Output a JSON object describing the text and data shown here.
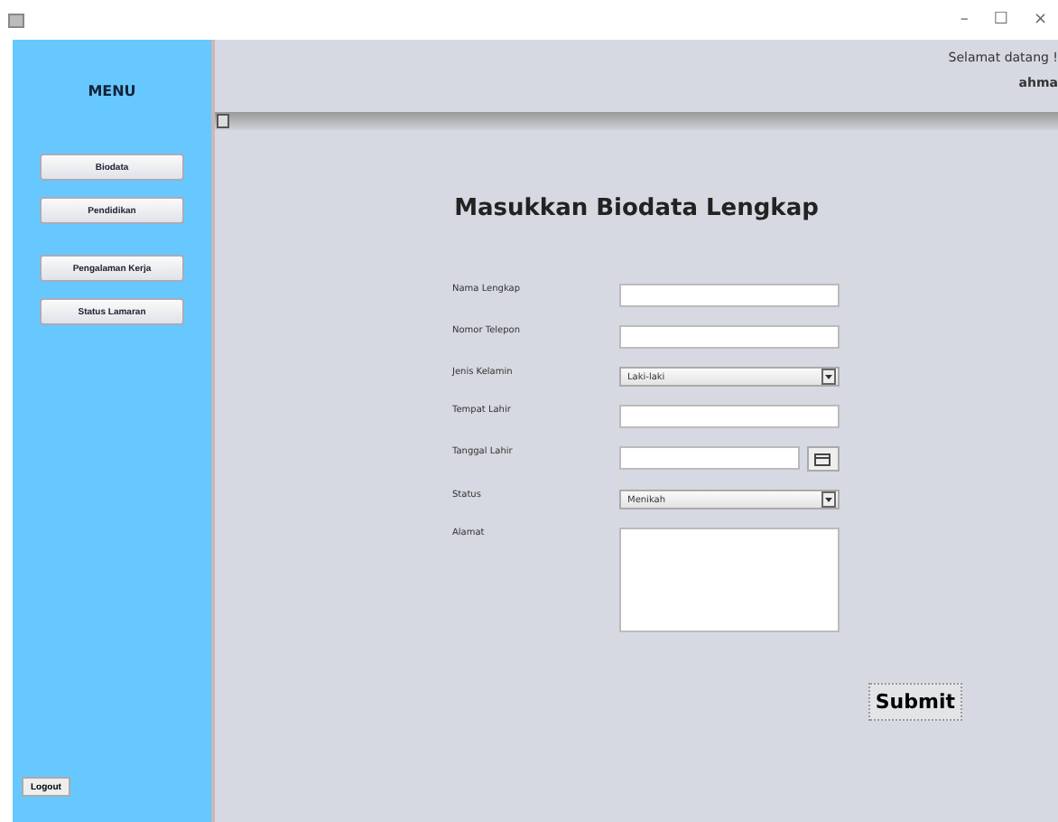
{
  "window": {
    "title_controls": [
      "–",
      "☐",
      "×"
    ]
  },
  "sidebar": {
    "title": "MENU",
    "items": [
      {
        "label": "Biodata"
      },
      {
        "label": "Pendidikan"
      },
      {
        "label": "Pengalaman Kerja"
      },
      {
        "label": "Status Lamaran"
      }
    ],
    "logout": "Logout"
  },
  "header": {
    "greeting": "Selamat datang !",
    "user": "ahma"
  },
  "form": {
    "title": "Masukkan Biodata Lengkap",
    "fields": [
      {
        "label": "Nama Lengkap",
        "kind": "text"
      },
      {
        "label": "Nomor Telepon",
        "kind": "text"
      },
      {
        "label": "Jenis Kelamin",
        "kind": "select",
        "value": "Laki-laki"
      },
      {
        "label": "Tempat Lahir",
        "kind": "text"
      },
      {
        "label": "Tanggal Lahir",
        "kind": "date"
      },
      {
        "label": "Status",
        "kind": "select",
        "value": "Menikah"
      },
      {
        "label": "Alamat",
        "kind": "area"
      }
    ],
    "submit": "Submit"
  }
}
